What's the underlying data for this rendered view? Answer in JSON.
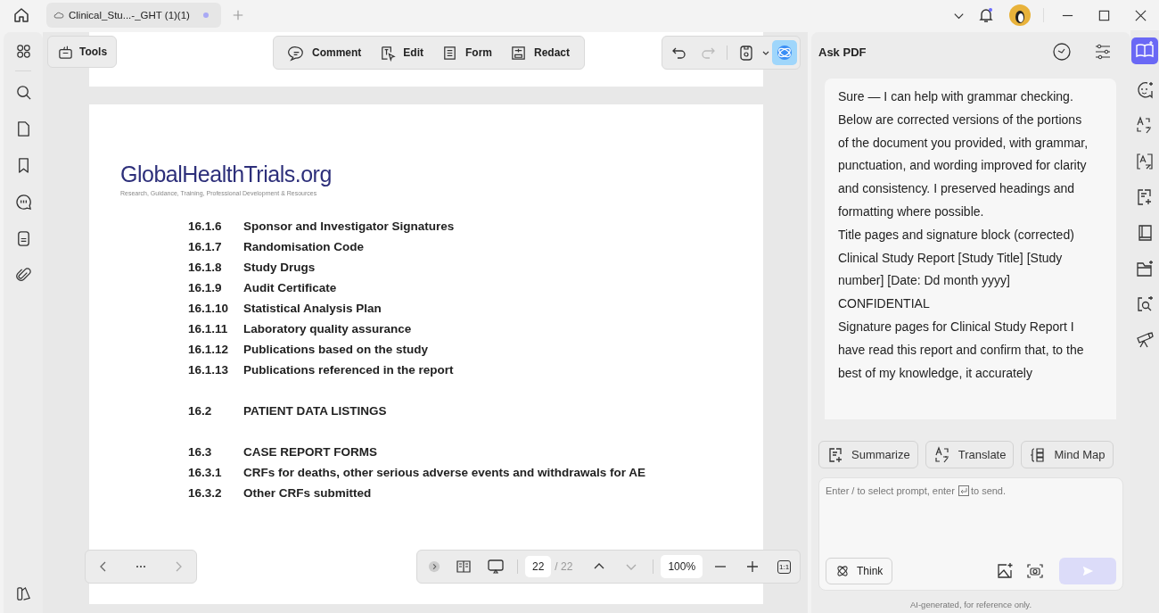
{
  "tab": {
    "title": "Clinical_Stu...-_GHT (1)(1)",
    "modified": true
  },
  "tools_button": "Tools",
  "edit_toolbar": [
    "Comment",
    "Edit",
    "Form",
    "Redact"
  ],
  "document": {
    "logo": {
      "part1": "GlobalHealth",
      "part2": "Trials.org",
      "tagline": "Research, Guidance, Training, Professional Development & Resources"
    },
    "toc_groups": [
      [
        {
          "number": "16.1.6",
          "title": "Sponsor and Investigator Signatures"
        },
        {
          "number": "16.1.7",
          "title": "Randomisation Code"
        },
        {
          "number": "16.1.8",
          "title": "Study Drugs"
        },
        {
          "number": "16.1.9",
          "title": "Audit Certificate"
        },
        {
          "number": "16.1.10",
          "title": "Statistical Analysis Plan"
        },
        {
          "number": "16.1.11",
          "title": "Laboratory quality assurance"
        },
        {
          "number": "16.1.12",
          "title": "Publications based on the study"
        },
        {
          "number": "16.1.13",
          "title": "Publications referenced in the report"
        }
      ],
      [
        {
          "number": "16.2",
          "title": "PATIENT DATA LISTINGS"
        }
      ],
      [
        {
          "number": "16.3",
          "title": "CASE REPORT FORMS"
        },
        {
          "number": "16.3.1",
          "title": "CRFs for deaths, other serious adverse events and withdrawals for AE"
        },
        {
          "number": "16.3.2",
          "title": "Other CRFs submitted"
        }
      ]
    ]
  },
  "page_nav": {
    "current": "22",
    "total": "/ 22",
    "zoom": "100%",
    "zoom_fit": "1:1"
  },
  "ask_pdf": {
    "title": "Ask PDF",
    "message": [
      "Sure — I can help with grammar checking. Below are corrected versions of the portions of the document you provided, with grammar, punctuation, and wording improved for clarity and consistency. I preserved headings and formatting where possible.",
      "Title pages and signature block (corrected)",
      "Clinical Study Report [Study Title] [Study number] [Date: Dd month yyyy]",
      "CONFIDENTIAL",
      "Signature pages for Clinical Study Report I have read this report and confirm that, to the best of my knowledge, it accurately"
    ],
    "quick_actions": [
      "Summarize",
      "Translate",
      "Mind Map"
    ],
    "placeholder_start": "Enter / to select prompt, enter",
    "placeholder_end": "to send.",
    "think": "Think",
    "footer": "AI-generated, for reference only."
  }
}
